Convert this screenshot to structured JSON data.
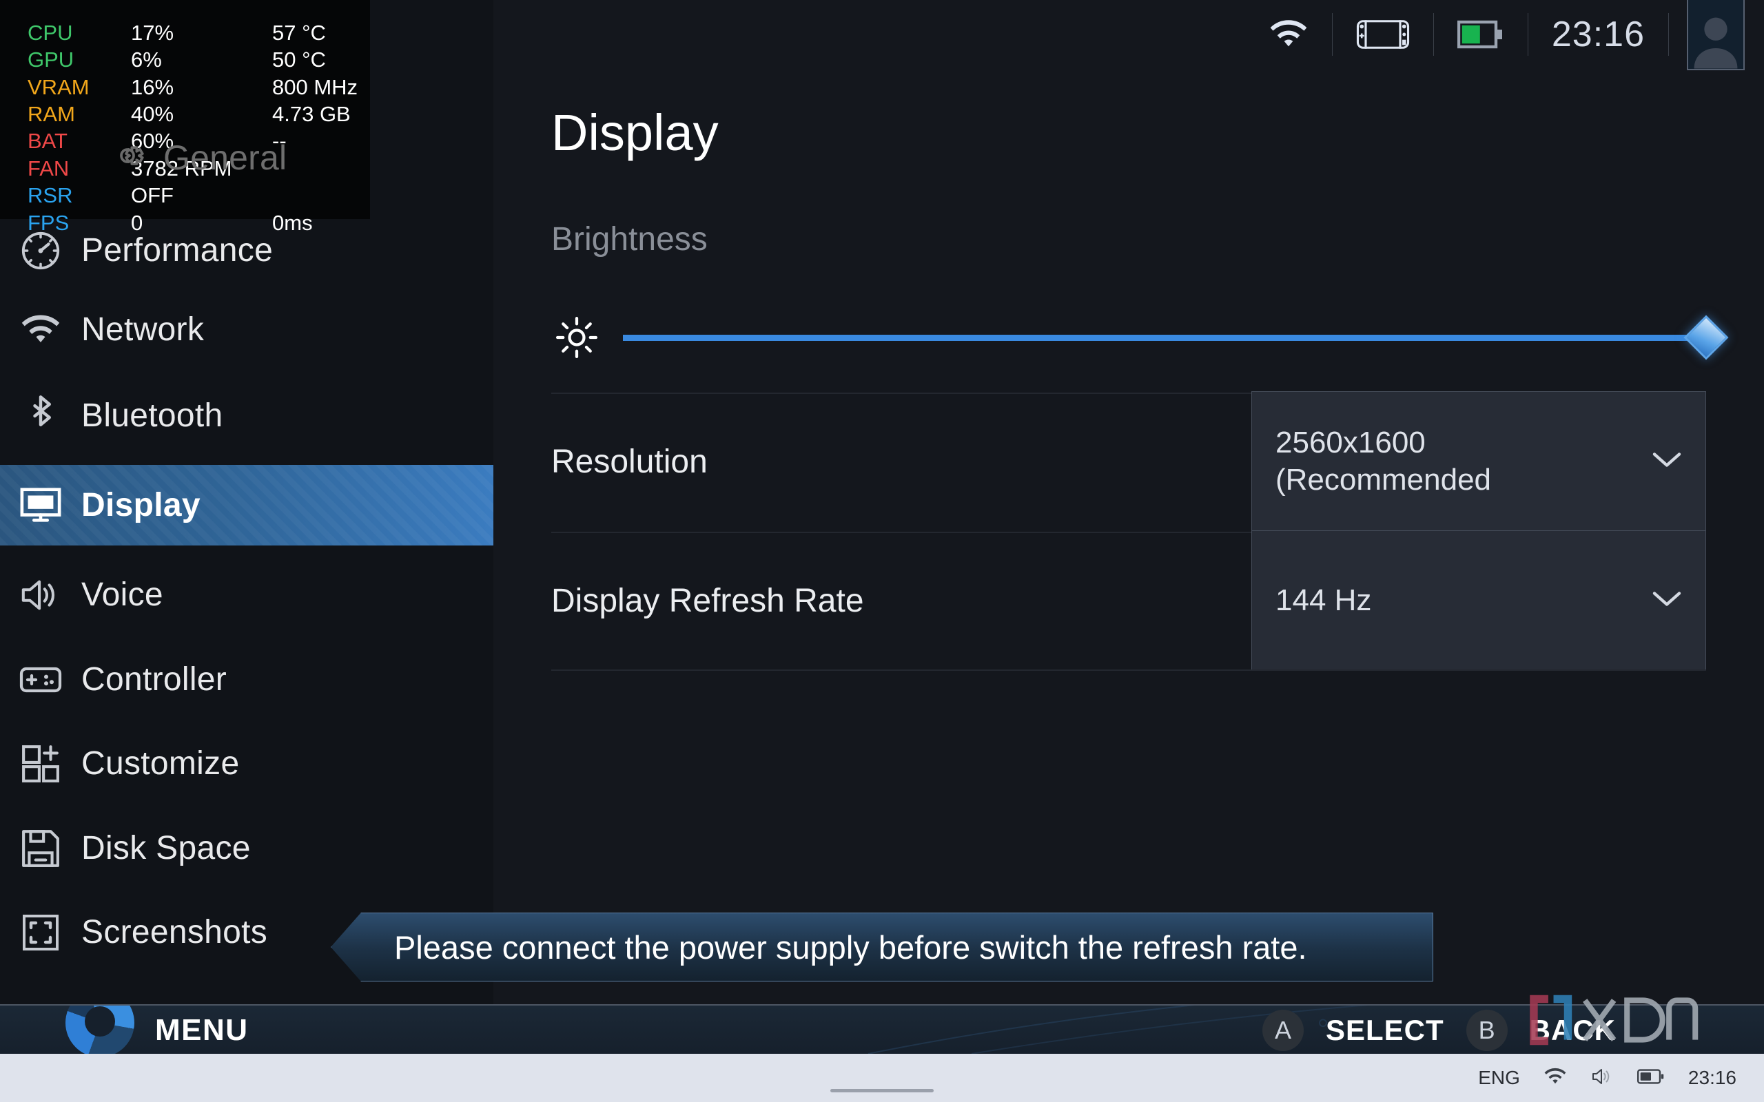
{
  "osd": {
    "watermark": "General",
    "rows": [
      {
        "label": "CPU",
        "color_class": "c-green",
        "v1": "17%",
        "v2": "57 °C"
      },
      {
        "label": "GPU",
        "color_class": "c-green",
        "v1": "6%",
        "v2": "50 °C"
      },
      {
        "label": "VRAM",
        "color_class": "c-orange",
        "v1": "16%",
        "v2": "800 MHz"
      },
      {
        "label": "RAM",
        "color_class": "c-orange",
        "v1": "40%",
        "v2": "4.73 GB"
      },
      {
        "label": "BAT",
        "color_class": "c-red",
        "v1": "60%",
        "v2": "--"
      },
      {
        "label": "FAN",
        "color_class": "c-red",
        "v1": "3782 RPM",
        "v2": ""
      },
      {
        "label": "RSR",
        "color_class": "c-blue",
        "v1": "OFF",
        "v2": ""
      },
      {
        "label": "FPS",
        "color_class": "c-blue",
        "v1": "0",
        "v2": "0ms"
      }
    ]
  },
  "sidebar": {
    "items": [
      {
        "label": "Performance",
        "icon": "speedometer-icon",
        "selected": false
      },
      {
        "label": "Network",
        "icon": "wifi-icon",
        "selected": false
      },
      {
        "label": "Bluetooth",
        "icon": "bluetooth-icon",
        "selected": false
      },
      {
        "label": "Display",
        "icon": "monitor-icon",
        "selected": true
      },
      {
        "label": "Voice",
        "icon": "speaker-icon",
        "selected": false
      },
      {
        "label": "Controller",
        "icon": "gamepad-icon",
        "selected": false
      },
      {
        "label": "Customize",
        "icon": "grid-plus-icon",
        "selected": false
      },
      {
        "label": "Disk Space",
        "icon": "floppy-disk-icon",
        "selected": false
      },
      {
        "label": "Screenshots",
        "icon": "crop-frame-icon",
        "selected": false
      }
    ]
  },
  "statusbar": {
    "wifi_icon": "wifi-icon",
    "device_icon": "handheld-device-icon",
    "battery_icon": "battery-icon",
    "clock": "23:16",
    "avatar_icon": "user-avatar-icon",
    "battery_level_percent": 60,
    "battery_color": "#18b34f"
  },
  "main": {
    "title": "Display",
    "brightness": {
      "label": "Brightness",
      "icon": "brightness-sun-icon",
      "value_percent": 100
    },
    "settings": [
      {
        "label": "Resolution",
        "value": "2560x1600\n(Recommended",
        "chevron": "chevron-down-icon"
      },
      {
        "label": "Display Refresh Rate",
        "value": "144 Hz",
        "chevron": "chevron-down-icon"
      }
    ]
  },
  "toast": {
    "message": "Please connect the power supply before switch the refresh rate."
  },
  "bottombar": {
    "menu_label": "MENU",
    "select_button": "A",
    "select_label": "SELECT",
    "back_button": "B",
    "back_label": "BACK"
  },
  "taskbar": {
    "language": "ENG",
    "wifi_icon": "wifi-icon",
    "volume_icon": "speaker-icon",
    "battery_icon": "battery-icon",
    "clock": "23:16"
  },
  "watermark": {
    "text": "XDA"
  },
  "colors": {
    "accent_blue": "#3a8ae0",
    "selected_nav": "#2f6496",
    "panel_bg": "#14171d",
    "sidebar_bg": "#101318",
    "dropdown_bg": "#272c36"
  }
}
